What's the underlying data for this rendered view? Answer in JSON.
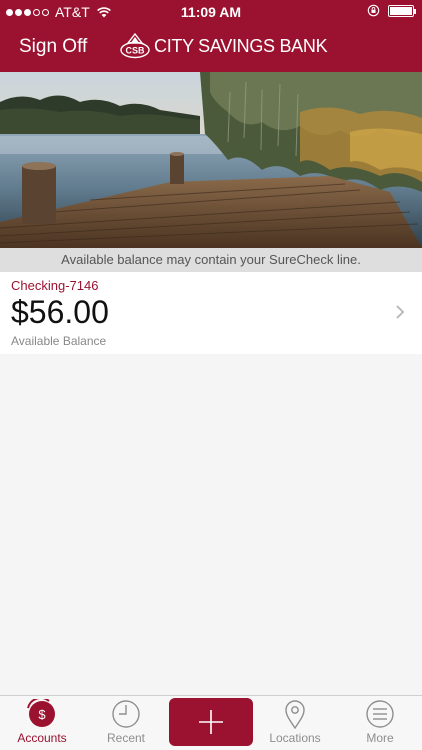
{
  "status_bar": {
    "carrier": "AT&T",
    "time": "11:09 AM",
    "signal_dots_filled": 3,
    "signal_dots_total": 5,
    "battery_level": 1.0,
    "icons": [
      "signal-dots-icon",
      "wifi-icon",
      "rotation-lock-icon",
      "battery-icon"
    ]
  },
  "header": {
    "sign_off_label": "Sign Off",
    "bank_name": "CITY SAVINGS BANK",
    "logo_initials": "CSB",
    "logo_subtext": "MEMBER FDIC"
  },
  "colors": {
    "brand": "#9b1230",
    "notice_bg": "#dedede",
    "page_bg": "#f5f5f5"
  },
  "notice": {
    "text": "Available balance may contain your SureCheck line."
  },
  "accounts": [
    {
      "name": "Checking-7146",
      "balance": "$56.00",
      "balance_label": "Available Balance"
    }
  ],
  "tabbar": {
    "tabs": [
      {
        "label": "Accounts",
        "icon": "dollar-coin-icon",
        "active": true
      },
      {
        "label": "Recent",
        "icon": "clock-icon",
        "active": false
      },
      {
        "label": "",
        "icon": "plus-icon",
        "active": false
      },
      {
        "label": "Locations",
        "icon": "map-pin-icon",
        "active": false
      },
      {
        "label": "More",
        "icon": "menu-lines-icon",
        "active": false
      }
    ]
  }
}
